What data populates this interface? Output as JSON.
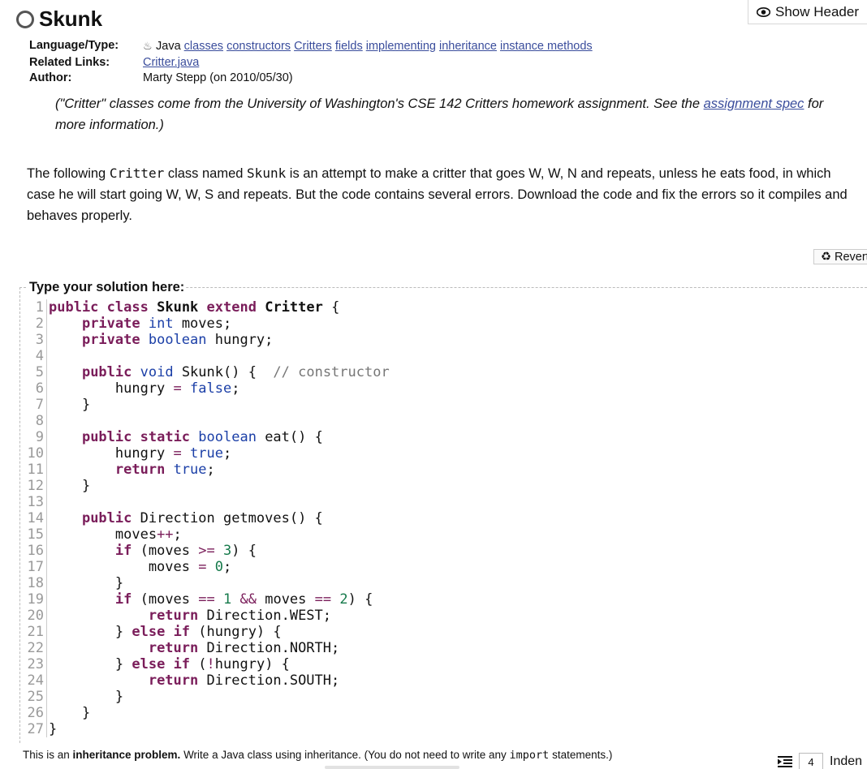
{
  "header": {
    "show_header_label": "Show Header"
  },
  "problem": {
    "title": "Skunk"
  },
  "meta": {
    "language_label": "Language/Type:",
    "language": "Java",
    "tags": [
      "classes",
      "constructors",
      "Critters",
      "fields",
      "implementing",
      "inheritance",
      "instance methods"
    ],
    "related_label": "Related Links:",
    "related_link": "Critter.java",
    "author_label": "Author:",
    "author": "Marty Stepp (on 2010/05/30)"
  },
  "note": {
    "text_before": "(\"Critter\" classes come from the University of Washington's CSE 142 Critters homework assignment. See the ",
    "link": "assignment spec",
    "text_after": " for more information.)"
  },
  "description": {
    "p1": "The following ",
    "code1": "Critter",
    "p2": " class named ",
    "code2": "Skunk",
    "p3": " is an attempt to make a critter that goes W, W, N and repeats, unless he eats food, in which case he will start going W, W, S and repeats. But the code contains several errors. Download the code and fix the errors so it compiles and behaves properly."
  },
  "revert_label": "Revert",
  "solution_label": "Type your solution here:",
  "line_numbers": [
    "1",
    "2",
    "3",
    "4",
    "5",
    "6",
    "7",
    "8",
    "9",
    "10",
    "11",
    "12",
    "13",
    "14",
    "15",
    "16",
    "17",
    "18",
    "19",
    "20",
    "21",
    "22",
    "23",
    "24",
    "25",
    "26",
    "27"
  ],
  "footer": {
    "prefix": "This is an ",
    "bold": "inheritance problem.",
    "mid": " Write a Java class using inheritance. (You do not need to write any ",
    "code": "import",
    "suffix": " statements.)",
    "indent_value": "4",
    "indent_label": "Indent"
  }
}
